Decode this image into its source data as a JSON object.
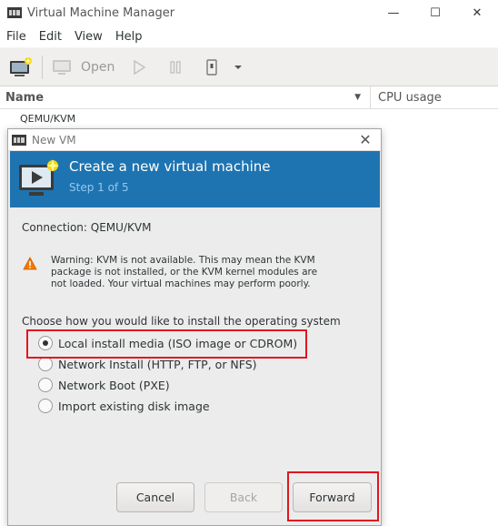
{
  "main_window": {
    "title": "Virtual Machine Manager",
    "controls": {
      "minimize": "—",
      "maximize": "☐",
      "close": "✕"
    },
    "menu": [
      "File",
      "Edit",
      "View",
      "Help"
    ],
    "toolbar": {
      "open_label": "Open"
    },
    "columns": {
      "name": "Name",
      "cpu": "CPU usage"
    },
    "connection_row": "QEMU/KVM"
  },
  "dialog": {
    "title": "New VM",
    "close": "✕",
    "banner": {
      "title": "Create a new virtual machine",
      "step": "Step 1 of 5"
    },
    "connection_label": "Connection:",
    "connection_value": "QEMU/KVM",
    "warning_lines": [
      "Warning: KVM is not available. This may mean the KVM",
      "package is not installed, or the KVM kernel modules are",
      "not loaded. Your virtual machines may perform poorly."
    ],
    "install_prompt": "Choose how you would like to install the operating system",
    "options": [
      {
        "label": "Local install media (ISO image or CDROM)",
        "checked": true
      },
      {
        "label": "Network Install (HTTP, FTP, or NFS)",
        "checked": false
      },
      {
        "label": "Network Boot (PXE)",
        "checked": false
      },
      {
        "label": "Import existing disk image",
        "checked": false
      }
    ],
    "buttons": {
      "cancel": "Cancel",
      "back": "Back",
      "forward": "Forward"
    }
  },
  "colors": {
    "banner": "#1e74b1",
    "highlight": "#e2161f"
  }
}
